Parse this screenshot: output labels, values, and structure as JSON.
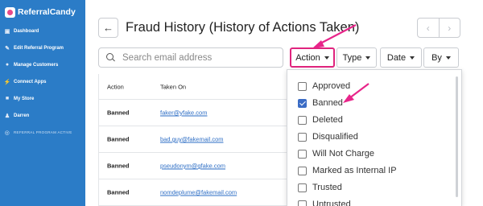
{
  "sidebar": {
    "brand": "ReferralCandy",
    "items": [
      {
        "label": "Dashboard",
        "icon": "dashboard-icon"
      },
      {
        "label": "Edit Referral Program",
        "icon": "gift-icon"
      },
      {
        "label": "Manage Customers",
        "icon": "users-icon"
      },
      {
        "label": "Connect Apps",
        "icon": "plug-icon"
      },
      {
        "label": "My Store",
        "icon": "briefcase-icon"
      },
      {
        "label": "Darren",
        "icon": "person-icon"
      },
      {
        "label": "REFERRAL PROGRAM ACTIVE",
        "icon": "wifi-icon"
      }
    ]
  },
  "header": {
    "title": "Fraud History (History of Actions Taken)"
  },
  "search": {
    "placeholder": "Search email address",
    "value": ""
  },
  "filters": [
    {
      "label": "Action"
    },
    {
      "label": "Type"
    },
    {
      "label": "Date"
    },
    {
      "label": "By"
    }
  ],
  "table": {
    "headers": [
      "Action",
      "Taken On"
    ],
    "rows": [
      {
        "action": "Banned",
        "email": "faker@yfake.com"
      },
      {
        "action": "Banned",
        "email": "bad.guy@fakemail.com"
      },
      {
        "action": "Banned",
        "email": "pseudonym@gfake.com"
      },
      {
        "action": "Banned",
        "email": "nomdeplume@fakemail.com"
      }
    ]
  },
  "action_dropdown": {
    "options": [
      {
        "label": "Approved",
        "checked": false
      },
      {
        "label": "Banned",
        "checked": true
      },
      {
        "label": "Deleted",
        "checked": false
      },
      {
        "label": "Disqualified",
        "checked": false
      },
      {
        "label": "Will Not Charge",
        "checked": false
      },
      {
        "label": "Marked as Internal IP",
        "checked": false
      },
      {
        "label": "Trusted",
        "checked": false
      },
      {
        "label": "Untrusted",
        "checked": false
      }
    ]
  },
  "colors": {
    "sidebar": "#2b7cc7",
    "highlight": "#e0247e",
    "link": "#2b6cc4",
    "checkbox": "#3b6cc5"
  }
}
